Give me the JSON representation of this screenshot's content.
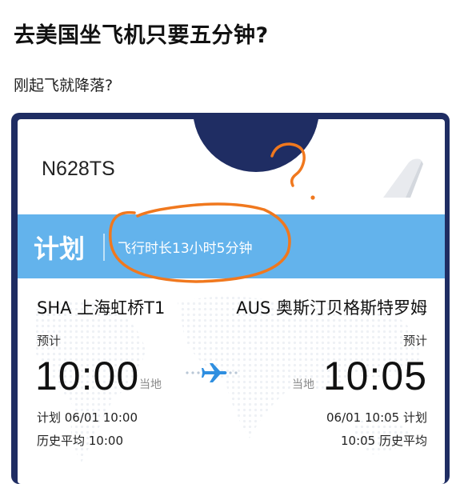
{
  "post": {
    "title": "去美国坐飞机只要五分钟?",
    "subtitle": "刚起飞就降落?"
  },
  "ticket": {
    "registration": "N628TS",
    "status_label": "计划",
    "duration": "飞行时长13小时5分钟",
    "departure": {
      "route": "SHA 上海虹桥T1",
      "estimate_label": "预计",
      "time": "10:00",
      "local_label": "当地",
      "scheduled": "计划 06/01 10:00",
      "history": "历史平均 10:00"
    },
    "arrival": {
      "route": "AUS 奥斯汀贝格斯特罗姆",
      "estimate_label": "预计",
      "time": "10:05",
      "local_label": "当地",
      "scheduled": "06/01 10:05 计划",
      "history": "10:05 历史平均"
    },
    "icons": [
      "airplane-icon",
      "tail-fin-icon"
    ],
    "colors": {
      "frame": "#1f2d63",
      "band": "#63b3ec",
      "plane": "#2f8fe0",
      "annotation": "#f0781e"
    }
  }
}
